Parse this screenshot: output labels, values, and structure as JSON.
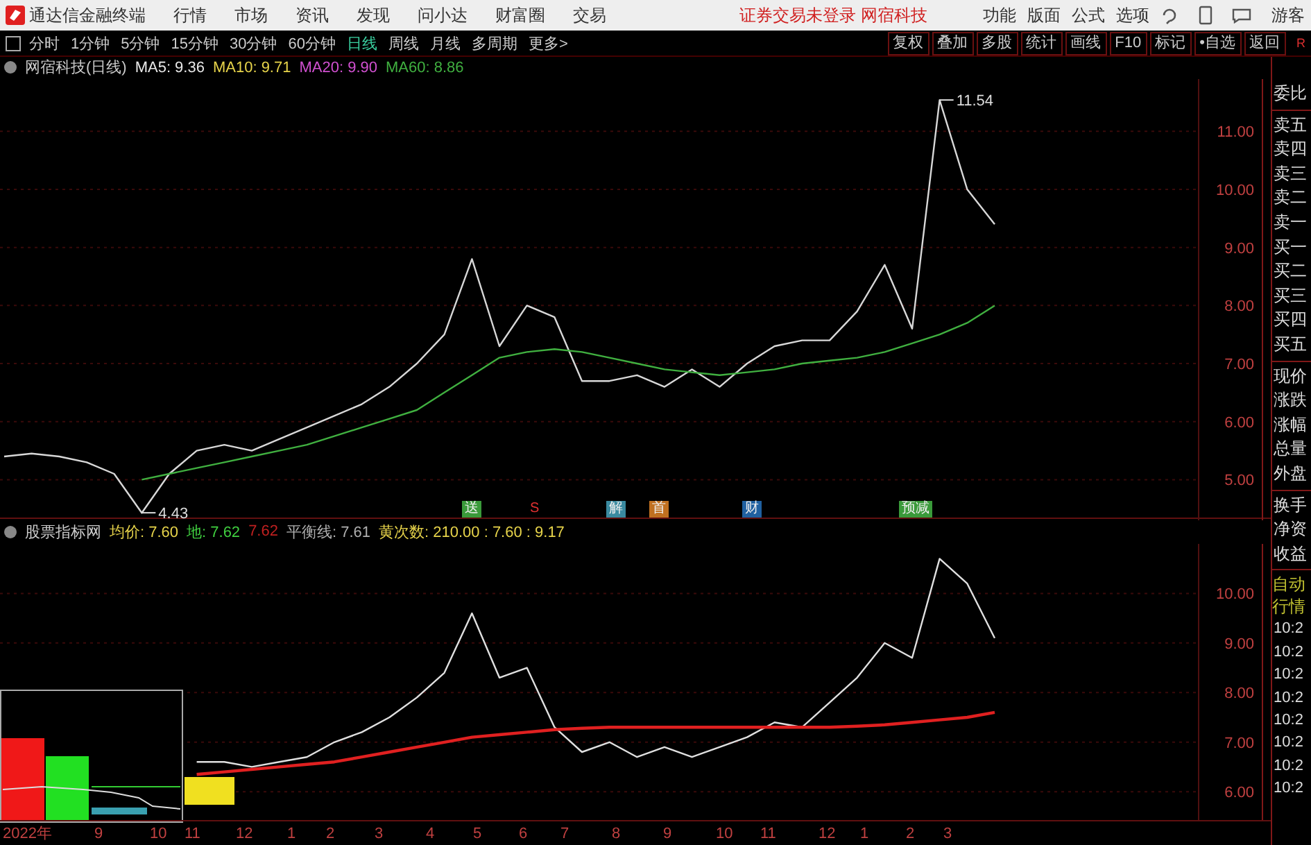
{
  "window": {
    "title": "通达信金融终端"
  },
  "menu": [
    "行情",
    "市场",
    "资讯",
    "发现",
    "问小达",
    "财富圈",
    "交易"
  ],
  "notice": "证券交易未登录 网宿科技",
  "top_actions": [
    "功能",
    "版面",
    "公式",
    "选项"
  ],
  "user": "游客",
  "periods": [
    {
      "label": "分时",
      "selected": false
    },
    {
      "label": "1分钟",
      "selected": false
    },
    {
      "label": "5分钟",
      "selected": false
    },
    {
      "label": "15分钟",
      "selected": false
    },
    {
      "label": "30分钟",
      "selected": false
    },
    {
      "label": "60分钟",
      "selected": false
    },
    {
      "label": "日线",
      "selected": true
    },
    {
      "label": "周线",
      "selected": false
    },
    {
      "label": "月线",
      "selected": false
    },
    {
      "label": "多周期",
      "selected": false
    },
    {
      "label": "更多>",
      "selected": false
    }
  ],
  "tools": [
    "复权",
    "叠加",
    "多股",
    "统计",
    "画线",
    "F10",
    "标记",
    "•自选",
    "返回"
  ],
  "tools_badge": "R",
  "main_chart": {
    "title": "网宿科技(日线)",
    "indicators": [
      {
        "text": "MA5: 9.36",
        "color": "#e8e8e8"
      },
      {
        "text": "MA10: 9.71",
        "color": "#e6d34a"
      },
      {
        "text": "MA20: 9.90",
        "color": "#d050d0"
      },
      {
        "text": "MA60: 8.86",
        "color": "#40b040"
      }
    ],
    "chart_data": {
      "type": "line",
      "grid": true,
      "ylim": [
        4.3,
        11.9
      ],
      "yticks": [
        {
          "value": 5,
          "label": "5.00"
        },
        {
          "value": 6,
          "label": "6.00"
        },
        {
          "value": 7,
          "label": "7.00"
        },
        {
          "value": 8,
          "label": "8.00"
        },
        {
          "value": 9,
          "label": "9.00"
        },
        {
          "value": 10,
          "label": "10.00"
        },
        {
          "value": 11,
          "label": "11.00"
        }
      ],
      "series": [
        {
          "color": "#d8d8d8",
          "values": [
            5.4,
            5.45,
            5.4,
            5.3,
            5.1,
            4.43,
            5.1,
            5.5,
            5.6,
            5.5,
            5.7,
            5.9,
            6.1,
            6.3,
            6.6,
            7.0,
            7.5,
            8.8,
            7.3,
            8.0,
            7.8,
            6.7,
            6.7,
            6.8,
            6.6,
            6.9,
            6.6,
            7.0,
            7.3,
            7.4,
            7.4,
            7.9,
            8.7,
            7.6,
            11.54,
            10.0,
            9.4
          ]
        },
        {
          "color": "#40b040",
          "values": [
            null,
            null,
            null,
            null,
            null,
            5.0,
            5.1,
            5.2,
            5.3,
            5.4,
            5.5,
            5.6,
            5.75,
            5.9,
            6.05,
            6.2,
            6.5,
            6.8,
            7.1,
            7.2,
            7.25,
            7.2,
            7.1,
            7.0,
            6.9,
            6.85,
            6.8,
            6.85,
            6.9,
            7.0,
            7.05,
            7.1,
            7.2,
            7.35,
            7.5,
            7.7,
            8.0
          ]
        }
      ],
      "annotations": [
        "11.54",
        "4.43"
      ]
    },
    "events": [
      {
        "label": "送",
        "color": "#3a9a3a"
      },
      {
        "label": "S",
        "color": "#000000"
      },
      {
        "label": "解",
        "color": "#3a8aa0"
      },
      {
        "label": "首",
        "color": "#c07020"
      },
      {
        "label": "财",
        "color": "#2060a0"
      },
      {
        "label": "预减",
        "color": "#3a9a3a"
      }
    ]
  },
  "sub_chart": {
    "title": "股票指标网",
    "indicators": [
      {
        "text": "均价: 7.60",
        "color": "#e6d34a"
      },
      {
        "text": "地: 7.62",
        "color": "#40d040"
      },
      {
        "text": "7.62",
        "color": "#c02020"
      },
      {
        "text": "平衡线: 7.61",
        "color": "#b0b0b0"
      },
      {
        "text": "黄次数: 210.00 : 7.60 : 9.17",
        "color": "#e6d34a"
      }
    ],
    "chart_data": {
      "type": "line",
      "grid": true,
      "ylim": [
        5.4,
        11.0
      ],
      "yticks": [
        {
          "value": 6,
          "label": "6.00"
        },
        {
          "value": 7,
          "label": "7.00"
        },
        {
          "value": 8,
          "label": "8.00"
        },
        {
          "value": 9,
          "label": "9.00"
        },
        {
          "value": 10,
          "label": "10.00"
        }
      ],
      "series": [
        {
          "color": "#e0e0e0",
          "values": [
            null,
            null,
            null,
            null,
            null,
            null,
            null,
            6.6,
            6.6,
            6.5,
            6.6,
            6.7,
            7.0,
            7.2,
            7.5,
            7.9,
            8.4,
            9.6,
            8.3,
            8.5,
            7.3,
            6.8,
            7.0,
            6.7,
            6.9,
            6.7,
            6.9,
            7.1,
            7.4,
            7.3,
            7.8,
            8.3,
            9.0,
            8.7,
            10.7,
            10.2,
            9.1
          ]
        },
        {
          "color": "#e02020",
          "values": [
            null,
            null,
            null,
            null,
            null,
            null,
            null,
            6.35,
            6.4,
            6.45,
            6.5,
            6.55,
            6.6,
            6.7,
            6.8,
            6.9,
            7.0,
            7.1,
            7.15,
            7.2,
            7.25,
            7.28,
            7.3,
            7.3,
            7.3,
            7.3,
            7.3,
            7.3,
            7.3,
            7.3,
            7.3,
            7.32,
            7.35,
            7.4,
            7.45,
            7.5,
            7.6
          ]
        }
      ]
    }
  },
  "dates": [
    "2022年",
    "9",
    "10",
    "11",
    "12",
    "1",
    "2",
    "3",
    "4",
    "5",
    "6",
    "7",
    "8",
    "9",
    "10",
    "11",
    "12",
    "1",
    "2",
    "3"
  ],
  "quote_labels": [
    "委比",
    "卖五",
    "卖四",
    "卖三",
    "卖二",
    "卖一",
    "买一",
    "买二",
    "买三",
    "买四",
    "买五",
    "现价",
    "涨跌",
    "涨幅",
    "总量",
    "外盘",
    "换手",
    "净资",
    "收益"
  ],
  "auto_labels": [
    "自动",
    "行情"
  ],
  "ticks": [
    "10:2",
    "10:2",
    "10:2",
    "10:2",
    "10:2",
    "10:2",
    "10:2",
    "10:2"
  ]
}
